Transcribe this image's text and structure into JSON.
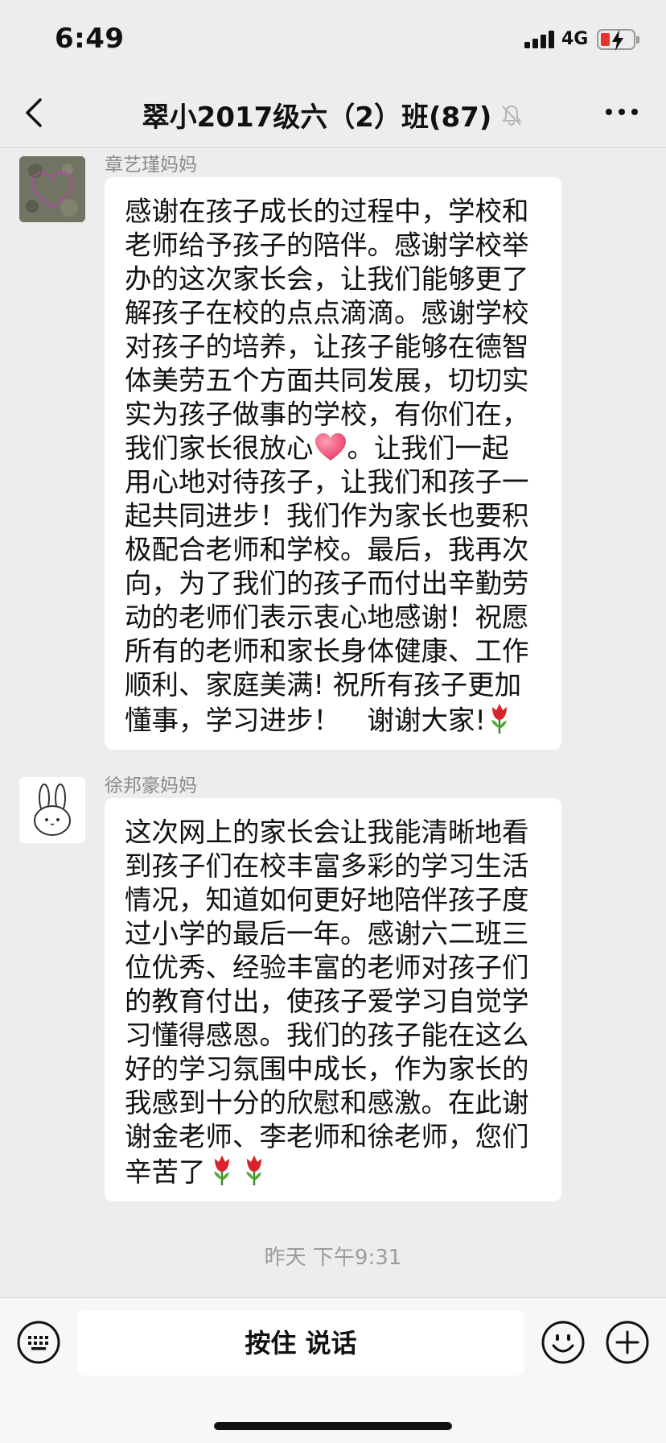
{
  "status_bar": {
    "time": "6:49",
    "network": "4G"
  },
  "nav": {
    "title": "翠小2017级六（2）班(87)"
  },
  "messages": [
    {
      "sender": "章艺瑾妈妈",
      "lines": [
        "感谢在孩子成长的过程中，学校和",
        "老师给予孩子的陪伴。感谢学校举",
        "办的这次家长会，让我们能够更了",
        "解孩子在校的点点滴滴。感谢学校",
        "对孩子的培养，让孩子能够在德智",
        "体美劳五个方面共同发展，切切实",
        "实为孩子做事的学校，有你们在，",
        "我们家长很放心",
        "用心地对待孩子，让我们和孩子一",
        "起共同进步！我们作为家长也要积",
        "极配合老师和学校。最后，我再次",
        "向，为了我们的孩子而付出辛勤劳",
        "动的老师们表示衷心地感谢！祝愿",
        "所有的老师和家长身体健康、工作",
        "顺利、家庭美满! 祝所有孩子更加",
        "懂事，学习进步！　谢谢大家!"
      ],
      "line8_after_heart": "。让我们一起"
    },
    {
      "sender": "徐邦豪妈妈",
      "lines": [
        "这次网上的家长会让我能清晰地看",
        "到孩子们在校丰富多彩的学习生活",
        "情况，知道如何更好地陪伴孩子度",
        "过小学的最后一年。感谢六二班三",
        "位优秀、经验丰富的老师对孩子们",
        "的教育付出，使孩子爱学习自觉学",
        "习懂得感恩。我们的孩子能在这么",
        "好的学习氛围中成长，作为家长的",
        "我感到十分的欣慰和感激。在此谢",
        "谢金老师、李老师和徐老师，您们",
        "辛苦了"
      ]
    }
  ],
  "timestamp": "昨天 下午9:31",
  "input_bar": {
    "talk_label": "按住 说话"
  },
  "colors": {
    "heart": "#e8436a",
    "tulip": "#d8242a",
    "battery_low": "#e8322d"
  },
  "icons": [
    "back-icon",
    "mute-icon",
    "more-icon",
    "keyboard-icon",
    "emoji-icon",
    "plus-icon",
    "heart-emoji",
    "tulip-emoji"
  ]
}
